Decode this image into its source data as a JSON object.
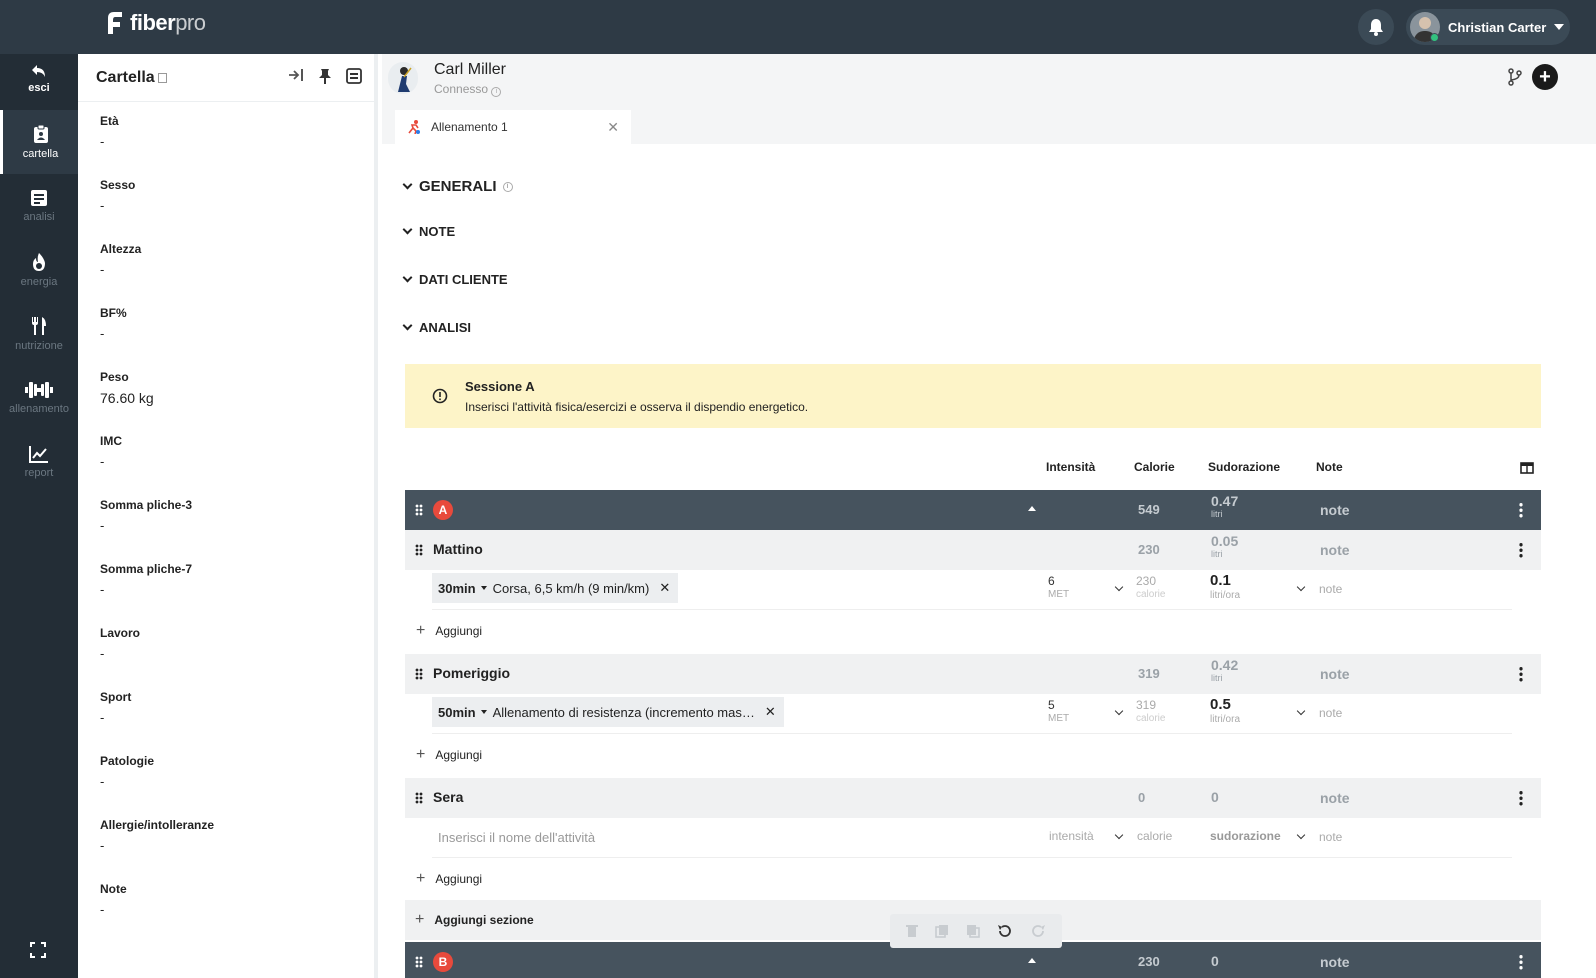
{
  "app": {
    "logo_main": "fiber",
    "logo_suffix": "pro"
  },
  "user": {
    "name": "Christian Carter"
  },
  "nav": [
    {
      "label": "esci",
      "icon": "back-arrow-icon"
    },
    {
      "label": "cartella",
      "icon": "clipboard-icon"
    },
    {
      "label": "analisi",
      "icon": "document-icon"
    },
    {
      "label": "energia",
      "icon": "flame-icon"
    },
    {
      "label": "nutrizione",
      "icon": "fork-knife-icon"
    },
    {
      "label": "allenamento",
      "icon": "dumbbell-icon"
    },
    {
      "label": "report",
      "icon": "chart-icon"
    }
  ],
  "cartella": {
    "title": "Cartella",
    "fields": [
      {
        "label": "Età",
        "value": "-"
      },
      {
        "label": "Sesso",
        "value": "-"
      },
      {
        "label": "Altezza",
        "value": "-"
      },
      {
        "label": "BF%",
        "value": "-"
      },
      {
        "label": "Peso",
        "value": "76.60 kg"
      },
      {
        "label": "IMC",
        "value": "-"
      },
      {
        "label": "Somma pliche-3",
        "value": "-"
      },
      {
        "label": "Somma pliche-7",
        "value": "-"
      },
      {
        "label": "Lavoro",
        "value": "-"
      },
      {
        "label": "Sport",
        "value": "-"
      },
      {
        "label": "Patologie",
        "value": "-"
      },
      {
        "label": "Allergie/intolleranze",
        "value": "-"
      },
      {
        "label": "Note",
        "value": "-"
      }
    ]
  },
  "client": {
    "name": "Carl Miller",
    "status": "Connesso"
  },
  "tab": {
    "label": "Allenamento 1"
  },
  "sections": {
    "generali": "GENERALI",
    "note": "NOTE",
    "dati_cliente": "DATI CLIENTE",
    "analisi": "ANALISI"
  },
  "alert": {
    "title": "Sessione A",
    "text": "Inserisci l'attività fisica/esercizi e osserva il dispendio energetico."
  },
  "columns": {
    "intensita": "Intensità",
    "calorie": "Calorie",
    "sudorazione": "Sudorazione",
    "note": "Note"
  },
  "session_a": {
    "badge": "A",
    "calories": "549",
    "sweat": "0.47",
    "sweat_unit": "litri",
    "note": "note"
  },
  "groups": {
    "mattino": {
      "title": "Mattino",
      "calories": "230",
      "sweat": "0.05",
      "sweat_unit": "litri",
      "note": "note"
    },
    "pomeriggio": {
      "title": "Pomeriggio",
      "calories": "319",
      "sweat": "0.42",
      "sweat_unit": "litri",
      "note": "note"
    },
    "sera": {
      "title": "Sera",
      "calories": "0",
      "sweat": "0",
      "note": "note"
    }
  },
  "activities": {
    "corsa": {
      "duration": "30min",
      "name": "Corsa, 6,5 km/h (9 min/km)",
      "met": "6",
      "met_unit": "MET",
      "calories": "230",
      "calories_unit": "calorie",
      "sweat": "0.1",
      "sweat_unit": "litri/ora",
      "note": "note"
    },
    "resistenza": {
      "duration": "50min",
      "name": "Allenamento di resistenza (incremento mas…",
      "met": "5",
      "met_unit": "MET",
      "calories": "319",
      "calories_unit": "calorie",
      "sweat": "0.5",
      "sweat_unit": "litri/ora",
      "note": "note"
    }
  },
  "sera_new": {
    "name_placeholder": "Inserisci il nome dell'attività",
    "intensity_placeholder": "intensità",
    "calories_placeholder": "calorie",
    "sweat_placeholder": "sudorazione",
    "note_placeholder": "note"
  },
  "actions": {
    "add": "Aggiungi",
    "add_section": "Aggiungi sezione"
  },
  "session_b": {
    "badge": "B",
    "calories": "230",
    "sweat": "0",
    "note": "note"
  }
}
